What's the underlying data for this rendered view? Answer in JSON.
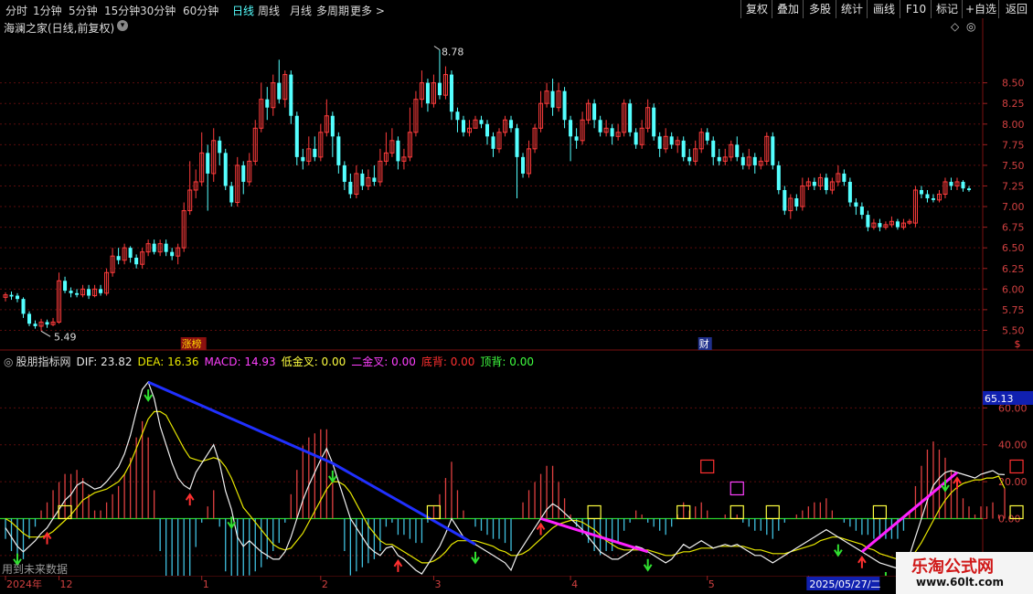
{
  "toolbar": {
    "periods": [
      "分时",
      "1分钟",
      "5分钟",
      "15分钟",
      "30分钟",
      "60分钟",
      "日线",
      "周线",
      "月线",
      "多周期",
      "更多 >"
    ],
    "active": "日线",
    "right_buttons": [
      "复权",
      "叠加",
      "多股",
      "统计",
      "画线",
      "F10",
      "标记",
      "+自选",
      "返回"
    ]
  },
  "main_panel": {
    "title": "海澜之家(日线,前复权)",
    "high_label": "8.78",
    "low_label": "5.49",
    "price_ticks": [
      "8.50",
      "8.25",
      "8.00",
      "7.75",
      "7.50",
      "7.25",
      "7.00",
      "6.75",
      "6.50",
      "6.25",
      "6.00",
      "5.75",
      "5.50"
    ],
    "markers": [
      {
        "text": "涨榜",
        "index": 31,
        "color": "#ffd700",
        "bg": "#8b1010"
      },
      {
        "text": "财",
        "index": 118,
        "color": "#ffffff",
        "bg": "#20308c"
      },
      {
        "text": "$",
        "index": 171,
        "color": "#ff4040",
        "bg": ""
      }
    ]
  },
  "indicator_panel": {
    "name": "股朋指标网",
    "items": [
      {
        "label": "DIF: 23.82",
        "color": "#e8e8e8"
      },
      {
        "label": "DEA: 16.36",
        "color": "#e8e800"
      },
      {
        "label": "MACD: 14.93",
        "color": "#ff40ff"
      },
      {
        "label": "低金叉: 0.00",
        "color": "#ffff40"
      },
      {
        "label": "二金叉: 0.00",
        "color": "#ff40ff"
      },
      {
        "label": "底背: 0.00",
        "color": "#ff3030"
      },
      {
        "label": "顶背: 0.00",
        "color": "#40ff40"
      }
    ],
    "ticks": [
      "60.00",
      "40.00",
      "20.00",
      "0.00",
      "-20.00"
    ],
    "highlight_value": "65.13"
  },
  "bottom": {
    "future_note": "用到未来数据",
    "date_labels": [
      {
        "text": "2024年",
        "index": 0
      },
      {
        "text": "12",
        "index": 9
      },
      {
        "text": "1",
        "index": 33
      },
      {
        "text": "2",
        "index": 53
      },
      {
        "text": "3",
        "index": 72
      },
      {
        "text": "4",
        "index": 95
      },
      {
        "text": "5",
        "index": 118
      },
      {
        "text": "2025/05/27/二",
        "index": 135
      }
    ]
  },
  "watermark": {
    "line1": "乐淘公式网",
    "line2": "www.60lt.com"
  },
  "chart_data": {
    "type": "candlestick",
    "ylim": [
      5.35,
      8.95
    ],
    "bars": [
      [
        5.9,
        5.93,
        5.96,
        5.85
      ],
      [
        5.93,
        5.91,
        5.97,
        5.87
      ],
      [
        5.92,
        5.88,
        5.95,
        5.84
      ],
      [
        5.88,
        5.7,
        5.9,
        5.65
      ],
      [
        5.7,
        5.58,
        5.73,
        5.55
      ],
      [
        5.58,
        5.55,
        5.62,
        5.52
      ],
      [
        5.55,
        5.6,
        5.64,
        5.49
      ],
      [
        5.6,
        5.57,
        5.63,
        5.53
      ],
      [
        5.57,
        5.6,
        5.65,
        5.55
      ],
      [
        5.6,
        6.1,
        6.2,
        5.58
      ],
      [
        6.1,
        5.98,
        6.15,
        5.95
      ],
      [
        5.98,
        5.95,
        6.02,
        5.9
      ],
      [
        5.95,
        5.93,
        6.0,
        5.9
      ],
      [
        5.93,
        6.0,
        6.05,
        5.9
      ],
      [
        6.0,
        5.92,
        6.05,
        5.88
      ],
      [
        5.92,
        6.0,
        6.05,
        5.9
      ],
      [
        6.0,
        5.95,
        6.05,
        5.92
      ],
      [
        5.95,
        6.2,
        6.25,
        5.92
      ],
      [
        6.2,
        6.4,
        6.5,
        6.15
      ],
      [
        6.4,
        6.35,
        6.5,
        6.3
      ],
      [
        6.35,
        6.5,
        6.55,
        6.3
      ],
      [
        6.5,
        6.38,
        6.52,
        6.32
      ],
      [
        6.38,
        6.3,
        6.42,
        6.25
      ],
      [
        6.3,
        6.45,
        6.5,
        6.25
      ],
      [
        6.45,
        6.55,
        6.6,
        6.4
      ],
      [
        6.55,
        6.45,
        6.6,
        6.42
      ],
      [
        6.45,
        6.55,
        6.6,
        6.4
      ],
      [
        6.55,
        6.45,
        6.6,
        6.4
      ],
      [
        6.45,
        6.4,
        6.5,
        6.35
      ],
      [
        6.4,
        6.5,
        6.55,
        6.3
      ],
      [
        6.5,
        6.95,
        7.05,
        6.45
      ],
      [
        6.95,
        7.2,
        7.55,
        6.9
      ],
      [
        7.2,
        7.3,
        7.45,
        7.1
      ],
      [
        7.3,
        7.65,
        7.9,
        7.25
      ],
      [
        7.65,
        7.4,
        7.75,
        6.95
      ],
      [
        7.4,
        7.8,
        7.95,
        7.3
      ],
      [
        7.8,
        7.65,
        7.85,
        7.5
      ],
      [
        7.65,
        7.25,
        7.7,
        7.2
      ],
      [
        7.25,
        7.05,
        7.3,
        7.0
      ],
      [
        7.05,
        7.5,
        7.6,
        7.0
      ],
      [
        7.5,
        7.3,
        7.55,
        7.15
      ],
      [
        7.3,
        7.55,
        7.65,
        7.25
      ],
      [
        7.55,
        7.95,
        8.05,
        7.5
      ],
      [
        7.95,
        8.3,
        8.5,
        7.9
      ],
      [
        8.3,
        8.2,
        8.45,
        8.05
      ],
      [
        8.2,
        8.5,
        8.6,
        8.1
      ],
      [
        8.5,
        8.3,
        8.78,
        8.25
      ],
      [
        8.3,
        8.6,
        8.65,
        8.2
      ],
      [
        8.6,
        8.1,
        8.65,
        8.0
      ],
      [
        8.1,
        7.6,
        8.15,
        7.5
      ],
      [
        7.6,
        7.55,
        7.7,
        7.45
      ],
      [
        7.55,
        7.7,
        7.85,
        7.5
      ],
      [
        7.7,
        7.6,
        7.85,
        7.55
      ],
      [
        7.6,
        7.9,
        8.0,
        7.55
      ],
      [
        7.9,
        8.1,
        8.3,
        7.85
      ],
      [
        8.1,
        7.85,
        8.15,
        7.6
      ],
      [
        7.85,
        7.5,
        7.9,
        7.4
      ],
      [
        7.5,
        7.3,
        7.55,
        7.2
      ],
      [
        7.3,
        7.15,
        7.4,
        7.1
      ],
      [
        7.15,
        7.4,
        7.5,
        7.1
      ],
      [
        7.4,
        7.25,
        7.45,
        7.2
      ],
      [
        7.25,
        7.35,
        7.45,
        7.2
      ],
      [
        7.35,
        7.3,
        7.5,
        7.25
      ],
      [
        7.3,
        7.55,
        7.7,
        7.25
      ],
      [
        7.55,
        7.65,
        7.9,
        7.5
      ],
      [
        7.65,
        7.8,
        7.95,
        7.6
      ],
      [
        7.8,
        7.55,
        7.85,
        7.45
      ],
      [
        7.55,
        7.6,
        7.7,
        7.45
      ],
      [
        7.6,
        7.9,
        8.2,
        7.55
      ],
      [
        7.9,
        8.3,
        8.4,
        7.85
      ],
      [
        8.3,
        8.5,
        8.65,
        8.2
      ],
      [
        8.5,
        8.25,
        8.55,
        8.15
      ],
      [
        8.25,
        8.5,
        8.6,
        8.2
      ],
      [
        8.5,
        8.35,
        8.9,
        8.3
      ],
      [
        8.35,
        8.6,
        8.7,
        8.3
      ],
      [
        8.6,
        8.15,
        8.65,
        8.05
      ],
      [
        8.15,
        8.05,
        8.2,
        7.9
      ],
      [
        8.05,
        7.9,
        8.1,
        7.85
      ],
      [
        7.9,
        7.95,
        8.05,
        7.85
      ],
      [
        7.95,
        8.05,
        8.1,
        7.95
      ],
      [
        8.05,
        8.0,
        8.1,
        7.95
      ],
      [
        8.0,
        7.85,
        8.05,
        7.75
      ],
      [
        7.85,
        7.7,
        7.9,
        7.6
      ],
      [
        7.7,
        7.9,
        7.95,
        7.65
      ],
      [
        7.9,
        8.05,
        8.1,
        7.85
      ],
      [
        8.05,
        7.95,
        8.1,
        7.9
      ],
      [
        7.95,
        7.6,
        8.0,
        7.1
      ],
      [
        7.6,
        7.4,
        7.65,
        7.35
      ],
      [
        7.4,
        7.7,
        7.8,
        7.35
      ],
      [
        7.7,
        7.95,
        8.0,
        7.65
      ],
      [
        7.95,
        8.25,
        8.4,
        7.9
      ],
      [
        8.25,
        8.4,
        8.5,
        8.2
      ],
      [
        8.4,
        8.2,
        8.55,
        8.1
      ],
      [
        8.2,
        8.4,
        8.5,
        8.15
      ],
      [
        8.4,
        8.05,
        8.45,
        7.95
      ],
      [
        8.05,
        7.85,
        8.1,
        7.55
      ],
      [
        7.85,
        7.8,
        7.95,
        7.7
      ],
      [
        7.8,
        8.05,
        8.15,
        7.75
      ],
      [
        8.05,
        8.25,
        8.3,
        8.0
      ],
      [
        8.25,
        8.05,
        8.3,
        7.95
      ],
      [
        8.05,
        7.9,
        8.1,
        7.85
      ],
      [
        7.9,
        7.95,
        8.05,
        7.85
      ],
      [
        7.95,
        7.85,
        8.0,
        7.75
      ],
      [
        7.85,
        7.9,
        8.0,
        7.8
      ],
      [
        7.9,
        8.25,
        8.3,
        7.85
      ],
      [
        8.25,
        7.9,
        8.3,
        7.85
      ],
      [
        7.9,
        7.75,
        7.95,
        7.7
      ],
      [
        7.75,
        7.95,
        8.05,
        7.7
      ],
      [
        7.95,
        8.2,
        8.3,
        7.9
      ],
      [
        8.2,
        7.85,
        8.25,
        7.8
      ],
      [
        7.85,
        7.7,
        7.9,
        7.6
      ],
      [
        7.7,
        7.85,
        7.95,
        7.65
      ],
      [
        7.85,
        7.75,
        7.9,
        7.7
      ],
      [
        7.75,
        7.8,
        7.85,
        7.65
      ],
      [
        7.8,
        7.6,
        7.85,
        7.55
      ],
      [
        7.6,
        7.55,
        7.7,
        7.5
      ],
      [
        7.55,
        7.7,
        7.8,
        7.5
      ],
      [
        7.7,
        7.9,
        7.95,
        7.65
      ],
      [
        7.9,
        7.8,
        7.95,
        7.75
      ],
      [
        7.8,
        7.6,
        7.85,
        7.5
      ],
      [
        7.6,
        7.55,
        7.7,
        7.5
      ],
      [
        7.55,
        7.6,
        7.7,
        7.5
      ],
      [
        7.6,
        7.75,
        7.8,
        7.55
      ],
      [
        7.75,
        7.6,
        7.85,
        7.55
      ],
      [
        7.6,
        7.5,
        7.65,
        7.45
      ],
      [
        7.5,
        7.6,
        7.7,
        7.45
      ],
      [
        7.6,
        7.5,
        7.65,
        7.4
      ],
      [
        7.5,
        7.55,
        7.6,
        7.45
      ],
      [
        7.55,
        7.85,
        7.9,
        7.5
      ],
      [
        7.85,
        7.5,
        7.9,
        7.45
      ],
      [
        7.5,
        7.2,
        7.55,
        7.15
      ],
      [
        7.2,
        6.95,
        7.25,
        6.9
      ],
      [
        6.95,
        7.1,
        7.15,
        6.85
      ],
      [
        7.1,
        7.0,
        7.15,
        6.95
      ],
      [
        7.0,
        7.25,
        7.35,
        6.95
      ],
      [
        7.25,
        7.3,
        7.35,
        7.2
      ],
      [
        7.3,
        7.25,
        7.35,
        7.2
      ],
      [
        7.25,
        7.35,
        7.4,
        7.2
      ],
      [
        7.35,
        7.2,
        7.4,
        7.15
      ],
      [
        7.2,
        7.3,
        7.35,
        7.15
      ],
      [
        7.3,
        7.4,
        7.5,
        7.25
      ],
      [
        7.4,
        7.3,
        7.45,
        7.25
      ],
      [
        7.3,
        7.05,
        7.35,
        7.0
      ],
      [
        7.05,
        7.0,
        7.1,
        6.9
      ],
      [
        7.0,
        6.9,
        7.05,
        6.85
      ],
      [
        6.9,
        6.75,
        6.95,
        6.7
      ],
      [
        6.75,
        6.8,
        6.85,
        6.72
      ],
      [
        6.8,
        6.75,
        6.85,
        6.7
      ],
      [
        6.75,
        6.78,
        6.82,
        6.72
      ],
      [
        6.78,
        6.82,
        6.88,
        6.75
      ],
      [
        6.82,
        6.75,
        6.85,
        6.72
      ],
      [
        6.75,
        6.8,
        6.85,
        6.72
      ],
      [
        6.8,
        6.82,
        6.85,
        6.78
      ],
      [
        6.8,
        7.2,
        7.25,
        6.75
      ],
      [
        7.2,
        7.15,
        7.25,
        7.1
      ],
      [
        7.15,
        7.1,
        7.2,
        7.05
      ],
      [
        7.1,
        7.08,
        7.15,
        7.05
      ],
      [
        7.08,
        7.15,
        7.2,
        7.05
      ],
      [
        7.15,
        7.3,
        7.35,
        7.1
      ],
      [
        7.3,
        7.25,
        7.35,
        7.2
      ],
      [
        7.25,
        7.3,
        7.35,
        7.2
      ],
      [
        7.3,
        7.22,
        7.32,
        7.18
      ],
      [
        7.22,
        7.2,
        7.25,
        7.18
      ]
    ],
    "macd": {
      "ylim": [
        -28,
        78
      ],
      "dif": [
        -5,
        -10,
        -15,
        -18,
        -15,
        -12,
        -8,
        -5,
        0,
        5,
        10,
        13,
        18,
        20,
        18,
        16,
        17,
        20,
        24,
        28,
        35,
        45,
        58,
        70,
        74,
        65,
        50,
        40,
        30,
        22,
        18,
        16,
        25,
        30,
        35,
        40,
        30,
        15,
        5,
        -10,
        -15,
        -12,
        -15,
        -18,
        -20,
        -22,
        -22,
        -18,
        -10,
        0,
        10,
        18,
        25,
        32,
        38,
        30,
        20,
        10,
        0,
        -5,
        -10,
        -15,
        -18,
        -20,
        -16,
        -15,
        -20,
        -22,
        -25,
        -28,
        -30,
        -25,
        -20,
        -15,
        -8,
        0,
        -5,
        -10,
        -12,
        -14,
        -16,
        -18,
        -20,
        -22,
        -24,
        -28,
        -20,
        -15,
        -10,
        -5,
        0,
        5,
        8,
        6,
        3,
        0,
        -3,
        -6,
        -10,
        -14,
        -18,
        -20,
        -22,
        -22,
        -20,
        -18,
        -15,
        -16,
        -18,
        -20,
        -22,
        -24,
        -22,
        -18,
        -14,
        -16,
        -14,
        -12,
        -14,
        -16,
        -15,
        -14,
        -15,
        -14,
        -16,
        -18,
        -20,
        -20,
        -22,
        -24,
        -22,
        -20,
        -18,
        -16,
        -14,
        -12,
        -10,
        -8,
        -6,
        -8,
        -10,
        -12,
        -14,
        -16,
        -18,
        -20,
        -22,
        -24,
        -25,
        -26,
        -27,
        -26,
        -20,
        -10,
        0,
        10,
        18,
        22,
        25,
        26,
        25,
        24,
        23,
        22,
        24,
        25,
        26,
        24,
        23.82
      ],
      "dea": [
        0,
        -2,
        -5,
        -8,
        -10,
        -10,
        -10,
        -9,
        -7,
        -4,
        -1,
        2,
        6,
        10,
        12,
        14,
        15,
        16,
        18,
        20,
        24,
        30,
        38,
        46,
        54,
        58,
        58,
        56,
        50,
        44,
        38,
        33,
        32,
        31,
        32,
        33,
        32,
        28,
        22,
        14,
        6,
        2,
        -2,
        -6,
        -10,
        -14,
        -16,
        -17,
        -16,
        -12,
        -8,
        -2,
        4,
        10,
        16,
        20,
        20,
        18,
        14,
        8,
        2,
        -4,
        -8,
        -12,
        -14,
        -14,
        -16,
        -18,
        -20,
        -22,
        -24,
        -24,
        -23,
        -21,
        -18,
        -14,
        -12,
        -12,
        -12,
        -12,
        -13,
        -14,
        -15,
        -17,
        -18,
        -20,
        -20,
        -19,
        -17,
        -14,
        -11,
        -8,
        -5,
        -3,
        -2,
        -1,
        -1,
        -2,
        -4,
        -6,
        -9,
        -12,
        -14,
        -16,
        -17,
        -17,
        -17,
        -17,
        -17,
        -18,
        -19,
        -20,
        -20,
        -19,
        -18,
        -18,
        -17,
        -16,
        -16,
        -16,
        -15,
        -15,
        -15,
        -15,
        -15,
        -16,
        -17,
        -17,
        -18,
        -19,
        -19,
        -19,
        -18,
        -17,
        -16,
        -15,
        -14,
        -12,
        -11,
        -10,
        -10,
        -11,
        -12,
        -13,
        -14,
        -16,
        -17,
        -19,
        -20,
        -21,
        -22,
        -23,
        -22,
        -18,
        -13,
        -7,
        -1,
        5,
        10,
        14,
        17,
        19,
        20,
        21,
        21,
        22,
        22,
        23,
        16.36
      ],
      "golden_up_markers": [
        7,
        31,
        66,
        90,
        144,
        160,
        171
      ],
      "death_down_markers": [
        2,
        24,
        38,
        55,
        79,
        108,
        140,
        148,
        151,
        158
      ]
    }
  }
}
